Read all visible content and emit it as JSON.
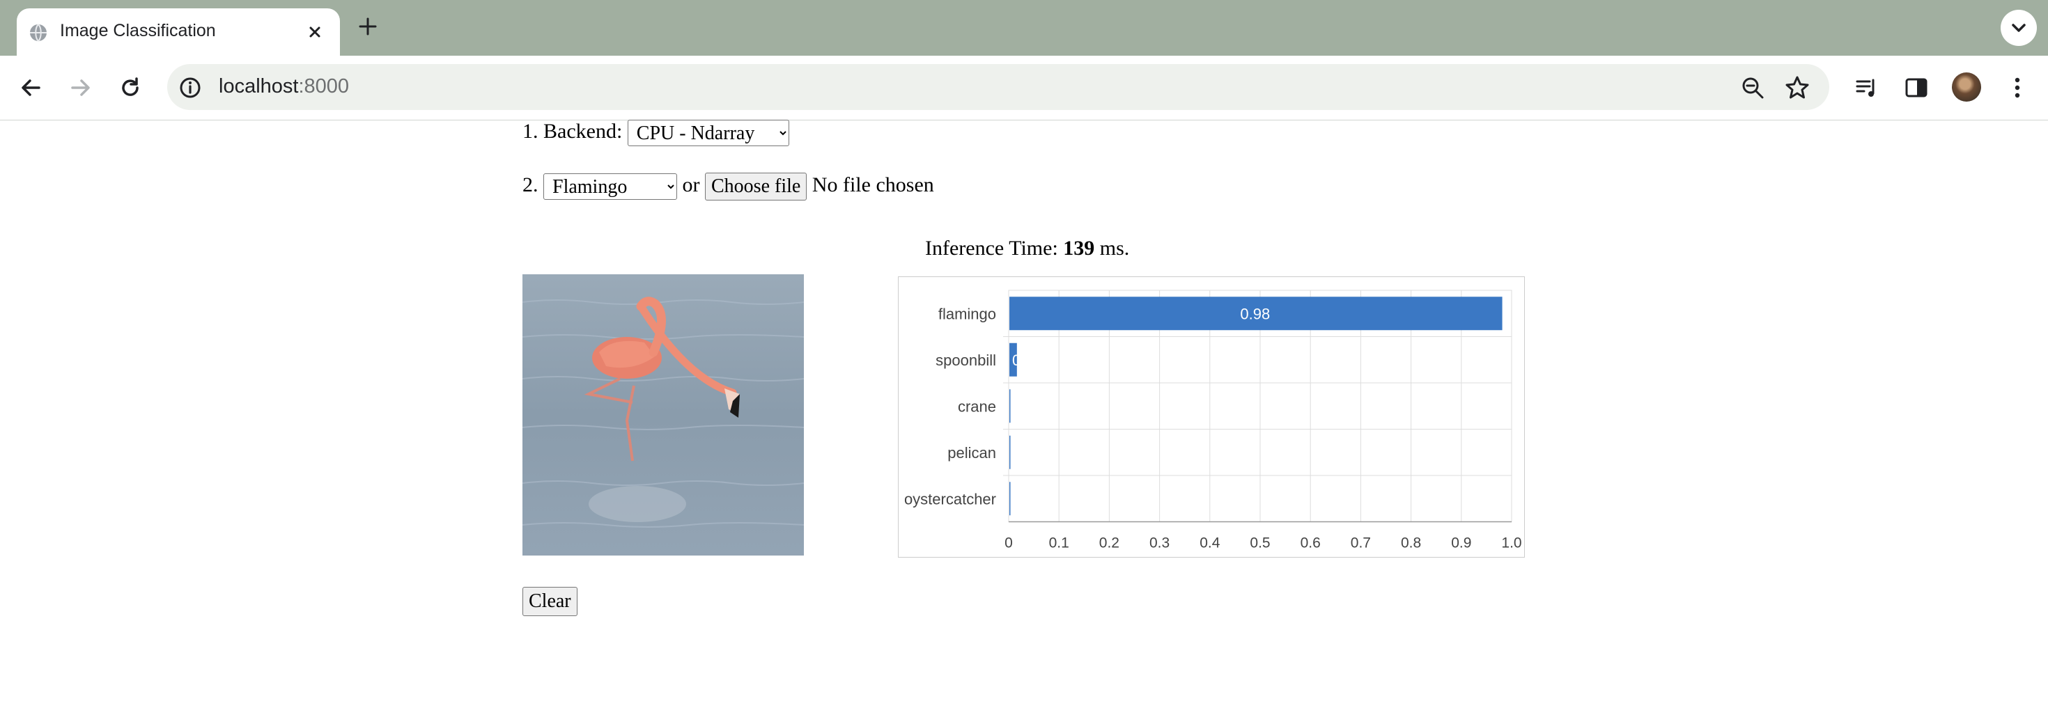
{
  "browser": {
    "tab_title": "Image Classification",
    "url_host": "localhost",
    "url_port": ":8000"
  },
  "page": {
    "backend_prefix": "1. Backend:",
    "backend_selected": "CPU - Ndarray",
    "image_prefix": "2.",
    "image_selected": "Flamingo",
    "or_text": "or",
    "choose_file_label": "Choose file",
    "no_file_text": "No file chosen",
    "inference_prefix": "Inference Time:",
    "inference_value": "139",
    "inference_unit": "ms.",
    "clear_label": "Clear"
  },
  "colors": {
    "bar": "#3b78c4",
    "tabstrip": "#a1afa0",
    "grid": "#dddddd"
  },
  "chart_data": {
    "type": "bar",
    "orientation": "horizontal",
    "categories": [
      "flamingo",
      "spoonbill",
      "crane",
      "pelican",
      "oystercatcher"
    ],
    "values": [
      0.98,
      0.015,
      0.002,
      0.002,
      0.001
    ],
    "value_labels": [
      "0.98",
      "0",
      "",
      "",
      ""
    ],
    "xlim": [
      0,
      1.0
    ],
    "xticks": [
      "0",
      "0.1",
      "0.2",
      "0.3",
      "0.4",
      "0.5",
      "0.6",
      "0.7",
      "0.8",
      "0.9",
      "1.0"
    ],
    "grid": true,
    "legend": "none"
  }
}
